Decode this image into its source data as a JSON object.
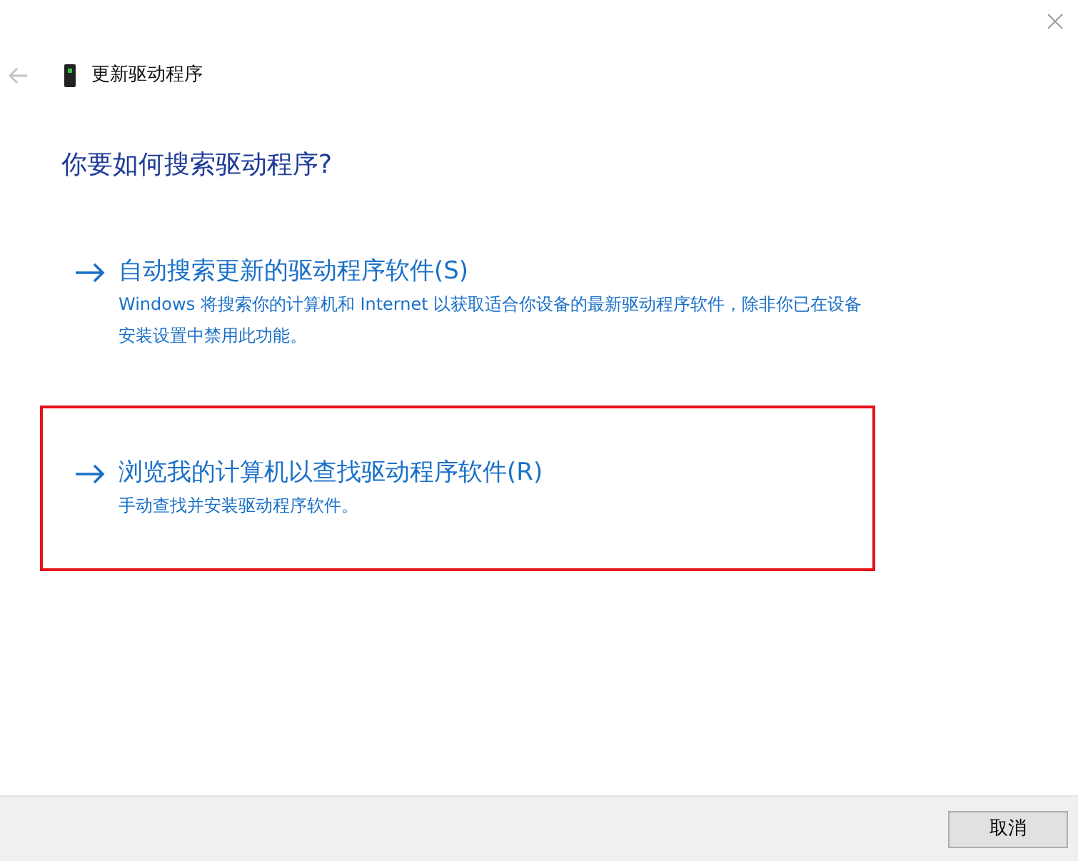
{
  "window": {
    "title": "更新驱动程序"
  },
  "heading": "你要如何搜索驱动程序?",
  "options": [
    {
      "title": "自动搜索更新的驱动程序软件(S)",
      "description": "Windows 将搜索你的计算机和 Internet 以获取适合你设备的最新驱动程序软件，除非你已在设备安装设置中禁用此功能。",
      "highlighted": false
    },
    {
      "title": "浏览我的计算机以查找驱动程序软件(R)",
      "description": "手动查找并安装驱动程序软件。",
      "highlighted": true
    }
  ],
  "buttons": [
    "取消"
  ]
}
